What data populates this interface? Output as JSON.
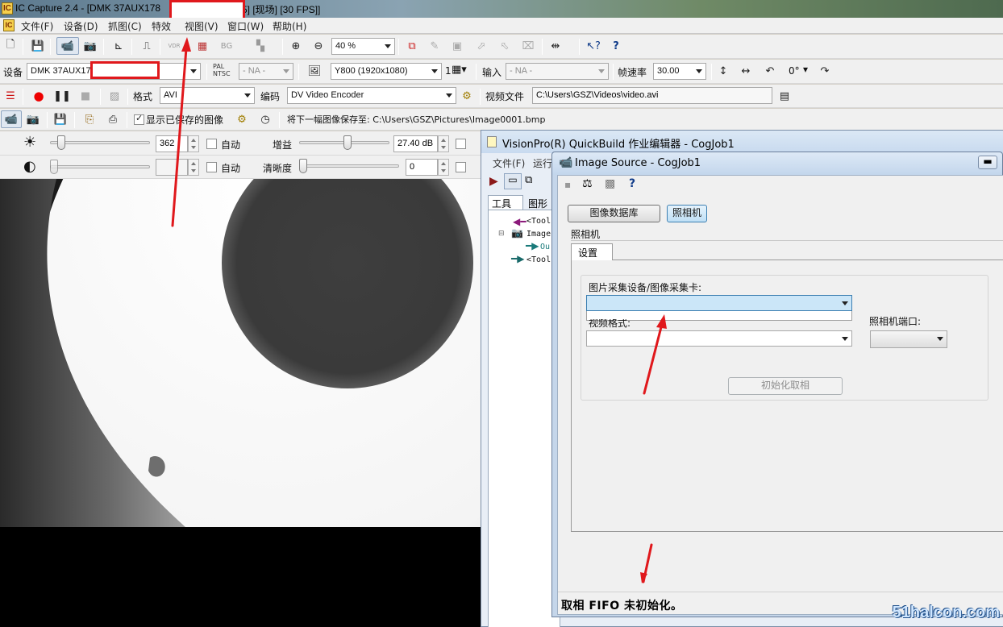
{
  "ic_capture": {
    "title_prefix": "IC Capture 2.4 - [DMK 37AUX178",
    "title_suffix": "5]  [现场]  [30 FPS]]",
    "menu": [
      "文件(F)",
      "设备(D)",
      "抓图(C)",
      "特效",
      "视图(V)",
      "窗口(W)",
      "帮助(H)"
    ],
    "toolbar1": {
      "zoom_value": "40 %",
      "bg_label": "BG",
      "vdr_label": "VDR"
    },
    "toolbar2": {
      "device_label": "设备",
      "device_value": "DMK 37AUX178",
      "pal_ntsc_label": "PAL NTSC",
      "video_norm_value": "- NA -",
      "format_value": "Y800 (1920x1080)",
      "binning_value": "1",
      "input_label": "输入",
      "input_value": "- NA -",
      "fps_label": "帧速率",
      "fps_value": "30.00",
      "rotation_value": "0°"
    },
    "toolbar3": {
      "format_label": "格式",
      "format_value": "AVI",
      "codec_label": "编码",
      "codec_value": "DV Video Encoder",
      "video_file_label": "视频文件",
      "video_file_value": "C:\\Users\\GSZ\\Videos\\video.avi"
    },
    "toolbar4": {
      "show_saved_label": "显示已保存的图像",
      "show_saved_checked": true,
      "save_next_label": "将下一幅图像保存至: C:\\Users\\GSZ\\Pictures\\Image0001.bmp"
    },
    "props": {
      "brightness_value": "362",
      "auto_label": "自动",
      "gain_label": "增益",
      "gain_value": "27.40 dB",
      "contrast_value": "",
      "sharpness_label": "清晰度",
      "sharpness_value": "0"
    }
  },
  "visionpro": {
    "title": "VisionPro(R) QuickBuild 作业编辑器 - CogJob1",
    "menu": [
      "文件(F)",
      "运行"
    ],
    "tabs": [
      "工具",
      "图形"
    ],
    "tree": [
      "<Tool(",
      "Image",
      "Ou",
      "<Tool("
    ]
  },
  "image_source": {
    "title": "Image Source - CogJob1",
    "btn_image_db": "图像数据库",
    "btn_camera": "照相机",
    "section_label": "照相机",
    "tab_settings": "设置",
    "device_label": "图片采集设备/图像采集卡:",
    "device_value": "",
    "video_format_label": "视频格式:",
    "video_format_value": "",
    "camera_port_label": "照相机端口:",
    "camera_port_value": "",
    "init_button": "初始化取相",
    "status": "取相 FIFO 未初始化。"
  },
  "watermark": "51halcon.com",
  "colors": {
    "annotation_red": "#e0181c",
    "selection_blue": "#cbe6f8"
  }
}
